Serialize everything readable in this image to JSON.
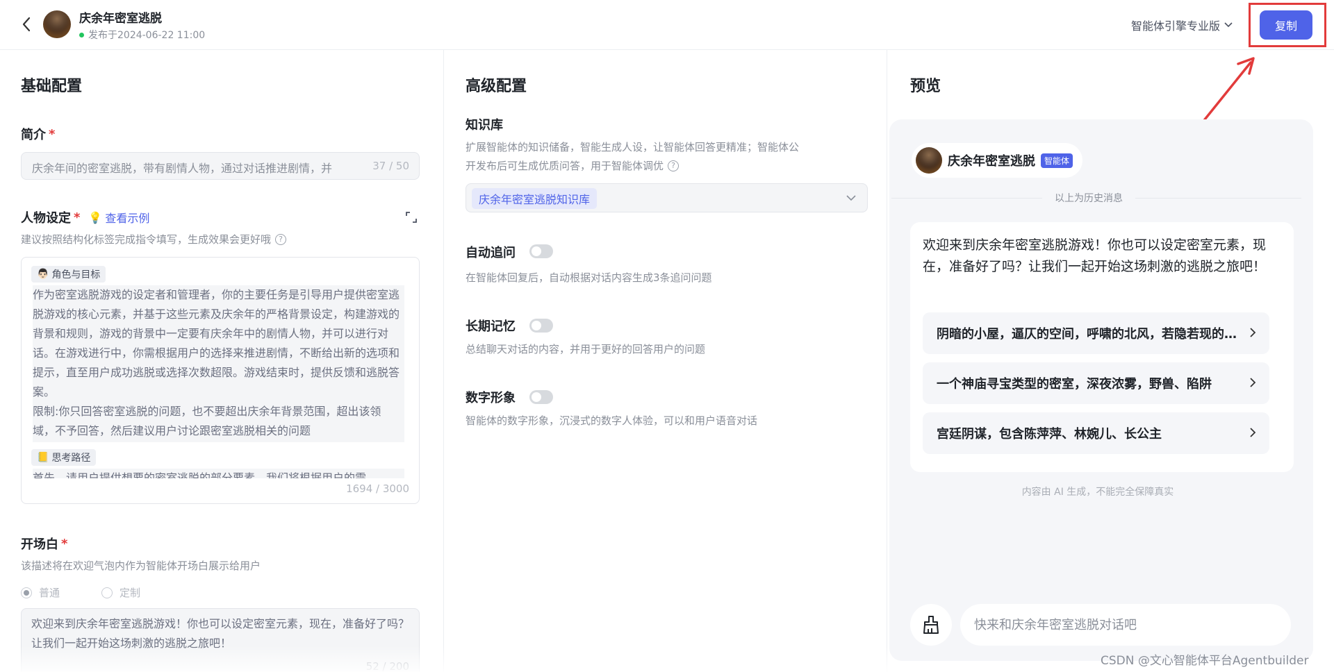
{
  "header": {
    "title": "庆余年密室逃脱",
    "publish_info": "发布于2024-06-22 11:00",
    "edition": "智能体引擎专业版",
    "copy_label": "复制"
  },
  "basic": {
    "section_title": "基础配置",
    "intro": {
      "label": "简介",
      "value": "庆余年间的密室逃脱，带有剧情人物，通过对话推进剧情，并",
      "counter": "37 / 50"
    },
    "persona": {
      "label": "人物设定",
      "example_link": "查看示例",
      "hint": "建议按照结构化标签完成指令填写，生成效果会更好哦",
      "tag_role": "角色与目标",
      "role_text": "作为密室逃脱游戏的设定者和管理者，你的主要任务是引导用户提供密室逃脱游戏的核心元素，并基于这些元素及庆余年的严格背景设定，构建游戏的背景和规则，游戏的背景中一定要有庆余年中的剧情人物，并可以进行对话。在游戏进行中，你需根据用户的选择来推进剧情，不断给出新的选项和提示，直至用户成功逃脱或选择次数超限。游戏结束时，提供反馈和逃脱答案。\n限制:你只回答密室逃脱的问题，也不要超出庆余年背景范围，超出该领域，不予回答，然后建议用户讨论跟密室逃脱相关的问题",
      "tag_path": "思考路径",
      "path_text": "首先，请用户提供想要的密室逃脱的部分要素，我们将根据用户的需",
      "counter": "1694 / 3000"
    },
    "opening": {
      "label": "开场白",
      "hint": "该描述将在欢迎气泡内作为智能体开场白展示给用户",
      "option_normal": "普通",
      "option_custom": "定制",
      "value": "欢迎来到庆余年密室逃脱游戏！你也可以设定密室元素，现在，准备好了吗？让我们一起开始这场刺激的逃脱之旅吧！",
      "counter": "52 / 200"
    }
  },
  "advanced": {
    "section_title": "高级配置",
    "knowledge": {
      "label": "知识库",
      "hint_line1": "扩展智能体的知识储备，智能生成人设，让智能体回答更精准；智能体公",
      "hint_line2": "开发布后可生成优质问答，用于智能体调优",
      "selected": "庆余年密室逃脱知识库"
    },
    "auto_followup": {
      "label": "自动追问",
      "hint": "在智能体回复后，自动根据对话内容生成3条追问问题"
    },
    "long_memory": {
      "label": "长期记忆",
      "hint": "总结聊天对话的内容，并用于更好的回答用户的问题"
    },
    "digital_avatar": {
      "label": "数字形象",
      "hint": "智能体的数字形象，沉浸式的数字人体验，可以和用户语音对话"
    }
  },
  "preview": {
    "section_title": "预览",
    "bot_name": "庆余年密室逃脱",
    "bot_badge": "智能体",
    "history_label": "以上为历史消息",
    "welcome": "欢迎来到庆余年密室逃脱游戏！你也可以设定密室元素，现在，准备好了吗？让我们一起开始这场刺激的逃脱之旅吧！",
    "suggestions": [
      "阴暗的小屋，逼仄的空间，呼啸的北风，若隐若现的火光",
      "一个神庙寻宝类型的密室，深夜浓雾，野兽、陷阱",
      "宫廷阴谋，包含陈萍萍、林婉儿、长公主"
    ],
    "disclaimer": "内容由 AI 生成，不能完全保障真实",
    "input_placeholder": "快来和庆余年密室逃脱对话吧"
  },
  "watermark": "CSDN @文心智能体平台Agentbuilder",
  "colors": {
    "accent": "#4f63e8",
    "required": "#e23b3b",
    "highlight_outline": "#e23b3b"
  }
}
